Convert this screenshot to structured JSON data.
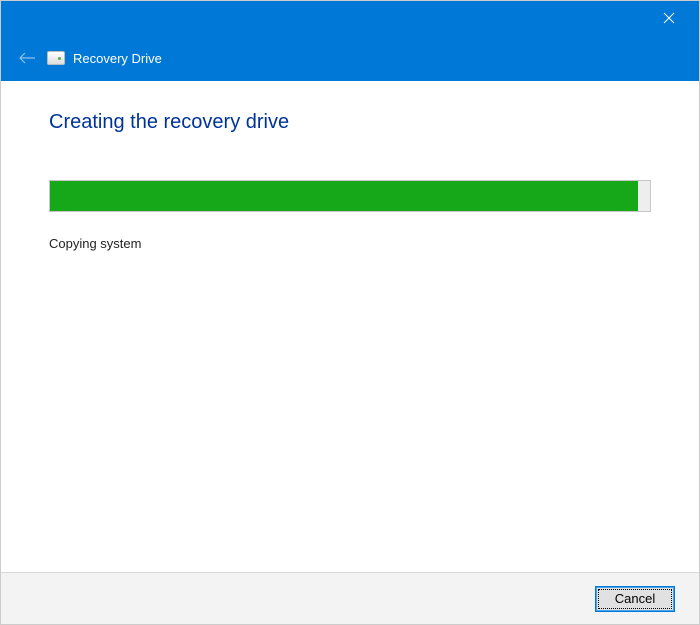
{
  "window": {
    "app_title": "Recovery Drive"
  },
  "page": {
    "title": "Creating the recovery drive",
    "progress_percent": 98,
    "status": "Copying system"
  },
  "footer": {
    "cancel_label": "Cancel"
  }
}
